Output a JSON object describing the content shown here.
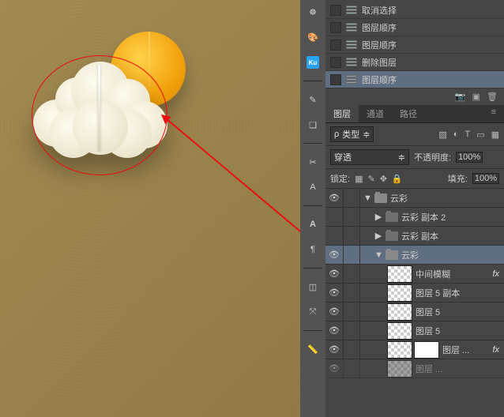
{
  "history": {
    "items": [
      {
        "label": "取消选择"
      },
      {
        "label": "图层顺序"
      },
      {
        "label": "图层顺序"
      },
      {
        "label": "删除图层"
      },
      {
        "label": "图层顺序"
      }
    ]
  },
  "panelTabs": {
    "layers": "图层",
    "channels": "通道",
    "paths": "路径"
  },
  "layerOptions": {
    "kind": "类型",
    "kindIcon": "ρ",
    "blend": "穿透",
    "opacityLabel": "不透明度:",
    "opacityVal": "100%",
    "lockLabel": "锁定:",
    "fillLabel": "填充:",
    "fillVal": "100%"
  },
  "layers": {
    "g1": "云彩",
    "g1a": "云彩 副本 2",
    "g1b": "云彩 副本",
    "g1c": "云彩",
    "l_mid": "中间模糊",
    "l_5b": "图层 5 副本",
    "l_5": "图层 5",
    "l_5c": "图层 5",
    "l_mask": "图层 ...",
    "l_last": "图层 ..."
  },
  "icons": {
    "eye": "👁",
    "wheel": "☸",
    "color": "🎨",
    "ku": "Ku",
    "brush": "¶",
    "clone": "❏",
    "ruler": "📏",
    "text": "A",
    "para": "¶",
    "cube": "◫",
    "axis": "⤧",
    "scissors": "✂",
    "font": "A",
    "camera": "📷",
    "trash": "🗑",
    "new": "▣",
    "menu": "≡",
    "search": "🔍",
    "twOpen": "▼",
    "twClosed": "▶",
    "lock": "🔒",
    "link": "🔗",
    "docT": "T",
    "rect": "▭",
    "circle": "○"
  }
}
